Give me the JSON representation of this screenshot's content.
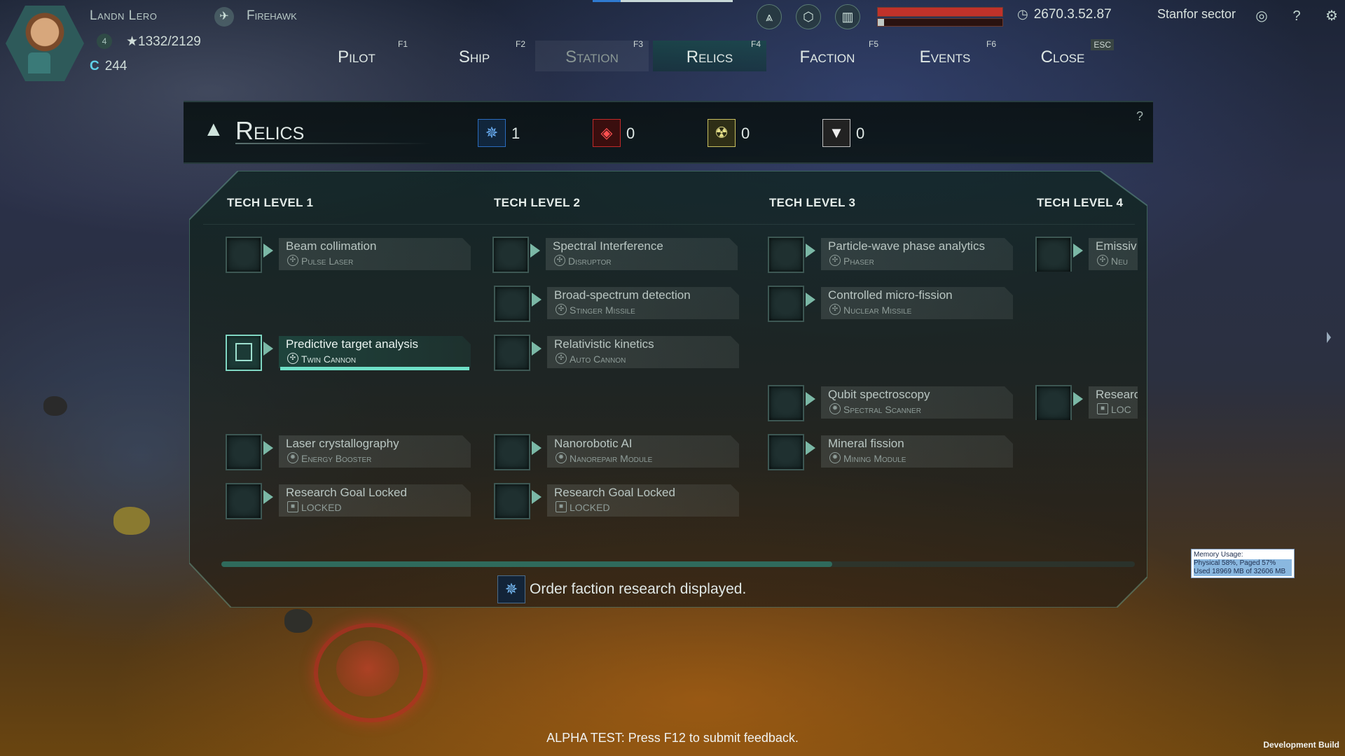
{
  "player": {
    "name": "Landn Lero",
    "ship": "Firehawk",
    "level": "4",
    "xp": "1332/2129",
    "credits": "244"
  },
  "status_bars": {
    "hull_fraction": 1.0,
    "shield_fraction": 0.05
  },
  "clock": "2670.3.52.87",
  "sector": "Stanfor sector",
  "icons": {
    "faction": "faction-emblem-icon",
    "hex": "hexagon-icon",
    "bars": "cargo-bars-icon",
    "clock": "clock-icon",
    "sector": "sector-target-icon",
    "help": "help-icon",
    "settings": "gear-icon"
  },
  "nav": [
    {
      "label": "Pilot",
      "key": "F1"
    },
    {
      "label": "Ship",
      "key": "F2"
    },
    {
      "label": "Station",
      "key": "F3"
    },
    {
      "label": "Relics",
      "key": "F4"
    },
    {
      "label": "Faction",
      "key": "F5"
    },
    {
      "label": "Events",
      "key": "F6"
    },
    {
      "label": "Close",
      "key": "ESC"
    }
  ],
  "relics": {
    "title": "Relics",
    "counters": [
      {
        "icon": "order-faction-icon",
        "value": "1",
        "color": "#2a6bbd"
      },
      {
        "icon": "red-target-icon",
        "value": "0",
        "color": "#c02a2a"
      },
      {
        "icon": "yellow-radiation-icon",
        "value": "0",
        "color": "#c8c060"
      },
      {
        "icon": "white-triangle-icon",
        "value": "0",
        "color": "#c0c0c0"
      }
    ],
    "help": "?"
  },
  "tech_levels": [
    "TECH LEVEL 1",
    "TECH LEVEL 2",
    "TECH LEVEL 3",
    "TECH LEVEL 4"
  ],
  "research": {
    "tl1": [
      {
        "title": "Beam collimation",
        "sub": "Pulse Laser"
      },
      {
        "title": "Predictive target analysis",
        "sub": "Twin Cannon"
      },
      {
        "title": "Laser crystallography",
        "sub": "Energy Booster"
      },
      {
        "title": "Research Goal Locked",
        "sub": "LOCKED"
      }
    ],
    "tl2": [
      {
        "title": "Spectral Interference",
        "sub": "Disruptor"
      },
      {
        "title": "Broad-spectrum detection",
        "sub": "Stinger Missile"
      },
      {
        "title": "Relativistic kinetics",
        "sub": "Auto Cannon"
      },
      {
        "title": "Nanorobotic AI",
        "sub": "Nanorepair Module"
      },
      {
        "title": "Research Goal Locked",
        "sub": "LOCKED"
      }
    ],
    "tl3": [
      {
        "title": "Particle-wave phase analytics",
        "sub": "Phaser"
      },
      {
        "title": "Controlled micro-fission",
        "sub": "Nuclear Missile"
      },
      {
        "title": "Qubit spectroscopy",
        "sub": "Spectral Scanner"
      },
      {
        "title": "Mineral fission",
        "sub": "Mining Module"
      }
    ],
    "tl4": [
      {
        "title": "Emissiv",
        "sub": "Neu"
      },
      {
        "title": "Researc",
        "sub": "LOC"
      }
    ]
  },
  "status_message": "Order faction research displayed.",
  "memory": {
    "l1": "Memory Usage:",
    "l2": "Physical 58%, Paged 57%",
    "l3": "Used 18969 MB of 32606 MB"
  },
  "alpha_notice": "ALPHA TEST: Press F12 to submit feedback.",
  "build_label": "Development Build"
}
